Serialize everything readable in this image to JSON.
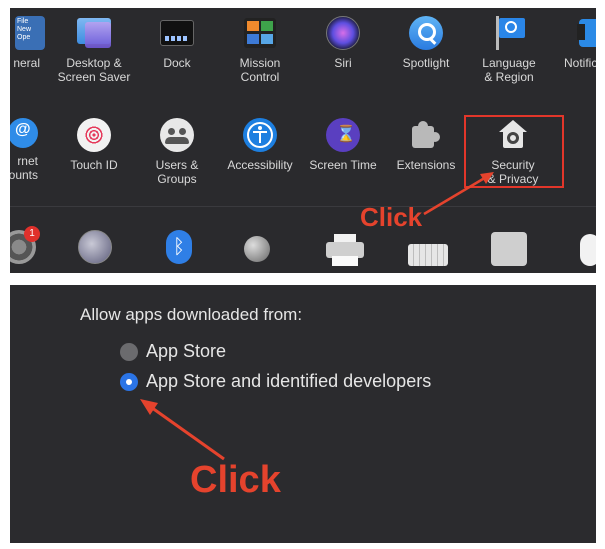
{
  "panel1": {
    "row1": [
      {
        "label": "neral",
        "icon": "general-icon"
      },
      {
        "label": "Desktop &\nScreen Saver",
        "icon": "desktop-screensaver-icon"
      },
      {
        "label": "Dock",
        "icon": "dock-icon"
      },
      {
        "label": "Mission\nControl",
        "icon": "mission-control-icon"
      },
      {
        "label": "Siri",
        "icon": "siri-icon"
      },
      {
        "label": "Spotlight",
        "icon": "spotlight-icon"
      },
      {
        "label": "Language\n& Region",
        "icon": "language-region-icon"
      },
      {
        "label": "Notifica",
        "icon": "notifications-icon"
      }
    ],
    "general_icon_text": "File\nNew\nOpe",
    "row2": [
      {
        "label": "rnet\nounts",
        "icon": "internet-accounts-icon"
      },
      {
        "label": "Touch ID",
        "icon": "touch-id-icon"
      },
      {
        "label": "Users &\nGroups",
        "icon": "users-groups-icon"
      },
      {
        "label": "Accessibility",
        "icon": "accessibility-icon"
      },
      {
        "label": "Screen Time",
        "icon": "screen-time-icon"
      },
      {
        "label": "Extensions",
        "icon": "extensions-icon"
      },
      {
        "label": "Security\n& Privacy",
        "icon": "security-privacy-icon"
      }
    ],
    "row3_icons": [
      "software-update-icon",
      "network-icon",
      "bluetooth-icon",
      "sound-icon",
      "printers-icon",
      "keyboard-icon",
      "trackpad-icon",
      "mouse-icon"
    ],
    "update_badge": "1",
    "annotation": "Click"
  },
  "panel2": {
    "title": "Allow apps downloaded from:",
    "options": [
      {
        "label": "App Store",
        "selected": false
      },
      {
        "label": "App Store and identified developers",
        "selected": true
      }
    ],
    "annotation": "Click"
  },
  "colors": {
    "highlight": "#e2362a",
    "radio_selected": "#2b74e6",
    "panel_bg": "#2a2a2d"
  }
}
